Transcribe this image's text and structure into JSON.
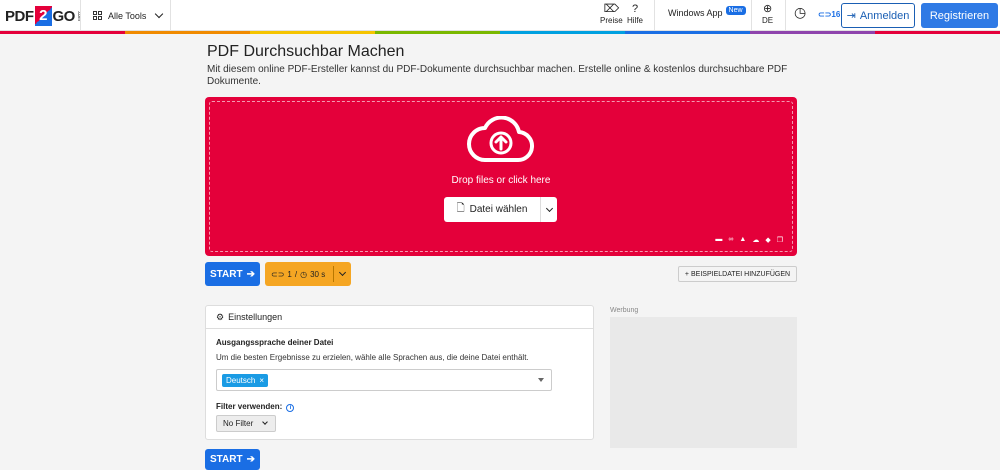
{
  "header": {
    "logo_left": "PDF",
    "logo_mid": "2",
    "logo_right": "GO",
    "logo_sub": ".com",
    "all_tools": "Alle Tools",
    "prices": "Preise",
    "help": "Hilfe",
    "windows_app": "Windows App",
    "new_badge": "New",
    "language": "DE",
    "credits": "16",
    "login": "Anmelden",
    "register": "Registrieren"
  },
  "rainbow_colors": [
    "#e4003a",
    "#f08a00",
    "#f5c400",
    "#7ab800",
    "#00a0e0",
    "#1a6ee4",
    "#8e44ad",
    "#e4003a"
  ],
  "page": {
    "title": "PDF Durchsuchbar Machen",
    "subtitle": "Mit diesem online PDF-Ersteller kannst du PDF-Dokumente durchsuchbar machen. Erstelle online & kostenlos durchsuchbare PDF Dokumente."
  },
  "dropzone": {
    "text": "Drop files or click here",
    "choose_button": "Datei wählen",
    "color": "#e4003a"
  },
  "actions": {
    "start": "START",
    "files_count": "1",
    "separator": "/",
    "time": "30 s",
    "sample_button": "BEISPIELDATEI HINZUFÜGEN"
  },
  "settings": {
    "header": "Einstellungen",
    "source_language_label": "Ausgangssprache deiner Datei",
    "source_language_desc": "Um die besten Ergebnisse zu erzielen, wähle alle Sprachen aus, die deine Datei enthält.",
    "selected_language": "Deutsch",
    "chip_remove": "×",
    "filter_label": "Filter verwenden:",
    "filter_value": "No Filter"
  },
  "ad": {
    "label": "Werbung"
  }
}
